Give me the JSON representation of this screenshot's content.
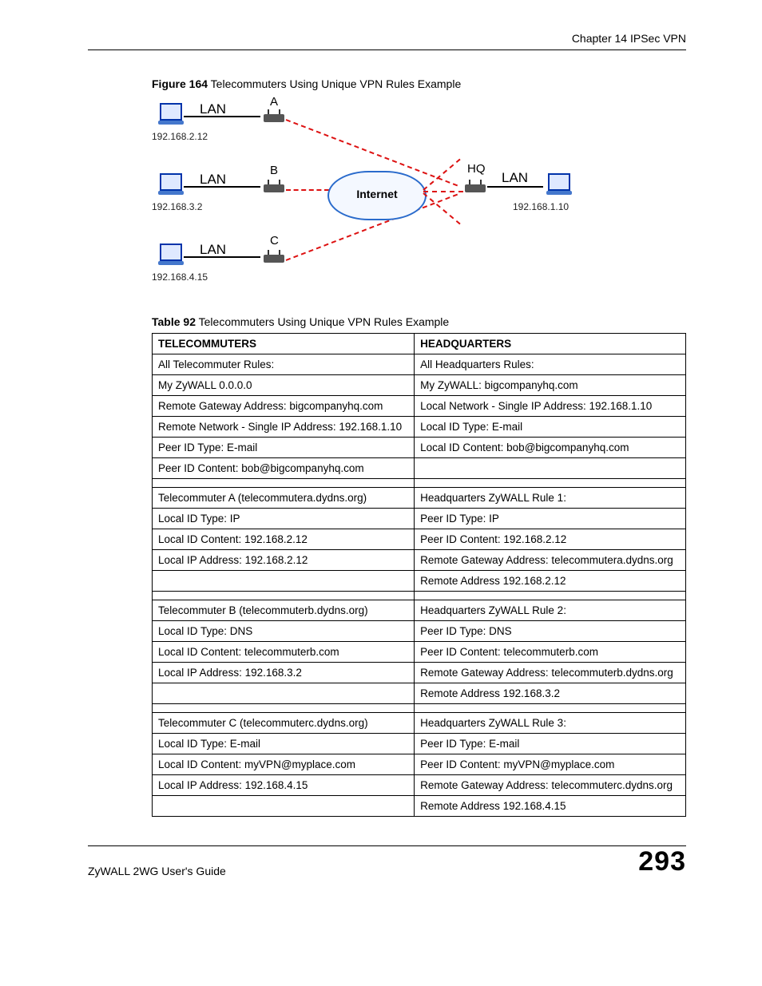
{
  "chapter_header": "Chapter 14 IPSec VPN",
  "figure_caption": {
    "bold": "Figure 164",
    "rest": "   Telecommuters Using Unique VPN Rules Example"
  },
  "table_caption": {
    "bold": "Table 92",
    "rest": "   Telecommuters Using Unique VPN Rules Example"
  },
  "diagram": {
    "lan_a_label": "LAN",
    "lan_b_label": "LAN",
    "lan_c_label": "LAN",
    "lan_hq_label": "LAN",
    "letter_a": "A",
    "letter_b": "B",
    "letter_c": "C",
    "letter_hq": "HQ",
    "ip_a": "192.168.2.12",
    "ip_b": "192.168.3.2",
    "ip_c": "192.168.4.15",
    "ip_hq": "192.168.1.10",
    "internet": "Internet"
  },
  "table": {
    "headers": {
      "left": "TELECOMMUTERS",
      "right": "HEADQUARTERS"
    },
    "rows": [
      {
        "l": "All Telecommuter Rules:",
        "r": "All Headquarters Rules:"
      },
      {
        "l": "My ZyWALL  0.0.0.0",
        "r": "My ZyWALL: bigcompanyhq.com"
      },
      {
        "l": "Remote Gateway Address: bigcompanyhq.com",
        "r": "Local Network - Single IP Address: 192.168.1.10"
      },
      {
        "l": "Remote Network - Single IP Address: 192.168.1.10",
        "r": "Local ID Type: E-mail"
      },
      {
        "l": "Peer ID Type: E-mail",
        "r": "Local ID Content: bob@bigcompanyhq.com"
      },
      {
        "l": "Peer ID Content: bob@bigcompanyhq.com",
        "r": ""
      },
      {
        "spacer": true
      },
      {
        "l": "Telecommuter A (telecommutera.dydns.org)",
        "r": "Headquarters ZyWALL Rule 1:"
      },
      {
        "l": "Local ID Type: IP",
        "r": "Peer ID Type: IP"
      },
      {
        "l": "Local ID Content: 192.168.2.12",
        "r": "Peer ID Content: 192.168.2.12"
      },
      {
        "l": "Local IP Address: 192.168.2.12",
        "r": "Remote Gateway Address: telecommutera.dydns.org"
      },
      {
        "l": "",
        "r": "Remote Address 192.168.2.12"
      },
      {
        "spacer": true
      },
      {
        "l": "Telecommuter B (telecommuterb.dydns.org)",
        "r": "Headquarters ZyWALL Rule 2:"
      },
      {
        "l": "Local ID Type: DNS",
        "r": "Peer ID Type: DNS"
      },
      {
        "l": "Local ID Content: telecommuterb.com",
        "r": "Peer ID Content: telecommuterb.com"
      },
      {
        "l": "Local IP Address: 192.168.3.2",
        "r": "Remote Gateway Address: telecommuterb.dydns.org"
      },
      {
        "l": "",
        "r": "Remote Address 192.168.3.2"
      },
      {
        "spacer": true
      },
      {
        "l": "Telecommuter C (telecommuterc.dydns.org)",
        "r": "Headquarters ZyWALL Rule 3:"
      },
      {
        "l": "Local ID Type: E-mail",
        "r": "Peer ID Type: E-mail"
      },
      {
        "l": "Local ID Content: myVPN@myplace.com",
        "r": "Peer ID Content: myVPN@myplace.com"
      },
      {
        "l": "Local IP Address: 192.168.4.15",
        "r": "Remote Gateway Address: telecommuterc.dydns.org"
      },
      {
        "l": "",
        "r": "Remote Address 192.168.4.15"
      }
    ]
  },
  "footer": {
    "guide": "ZyWALL 2WG User's Guide",
    "page_number": "293"
  }
}
